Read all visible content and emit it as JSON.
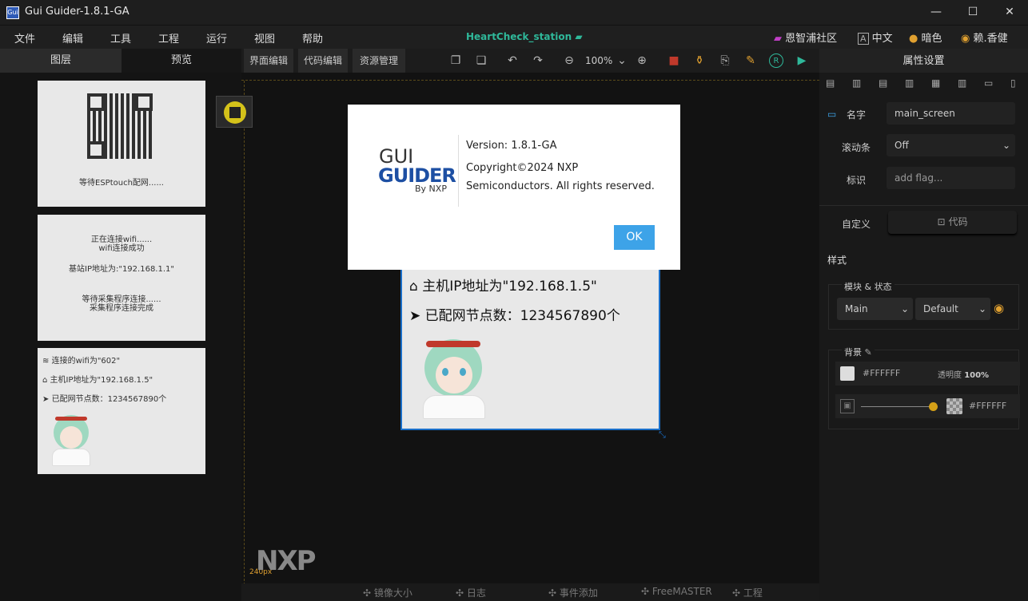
{
  "window": {
    "app_icon_text": "Gui",
    "title": "Gui Guider-1.8.1-GA",
    "minimize": "—",
    "maximize": "☐",
    "close": "✕"
  },
  "menu": {
    "items": [
      "文件",
      "编辑",
      "工具",
      "工程",
      "运行",
      "视图",
      "帮助"
    ],
    "project": "HeartCheck_station",
    "community": "恩智浦社区",
    "language": "中文",
    "theme": "暗色",
    "user": "赖.香健"
  },
  "left_panel": {
    "tab_layers": "图层",
    "tab_preview": "预览",
    "thumb1": {
      "caption": "等待ESPtouch配网......"
    },
    "thumb2": {
      "line1": "正在连接wifi......",
      "line2": "wifi连接成功",
      "line3": "基站IP地址为:\"192.168.1.1\"",
      "line4": "等待采集程序连接......",
      "line5": "采集程序连接完成"
    },
    "thumb3": {
      "wifi": "连接的wifi为\"602\"",
      "ip": "主机IP地址为\"192.168.1.5\"",
      "nodes": "已配网节点数：1234567890个"
    }
  },
  "editor": {
    "tab_ui": "界面编辑",
    "tab_code": "代码编辑",
    "tab_resources": "资源管理",
    "zoom": "100%",
    "ruler_label": "240px",
    "canvas": {
      "ip": "主机IP地址为\"192.168.1.5\"",
      "nodes": "已配网节点数：1234567890个"
    },
    "bottom_tabs": [
      "镜像大小",
      "日志",
      "事件添加",
      "FreeMASTER",
      "工程"
    ],
    "watermark": "NXP"
  },
  "right_panel": {
    "title": "属性设置",
    "name_label": "名字",
    "name_value": "main_screen",
    "scroll_label": "滚动条",
    "scroll_value": "Off",
    "flag_label": "标识",
    "flag_placeholder": "add flag...",
    "custom_label": "自定义",
    "code_button": "代码",
    "style_label": "样式",
    "module_state_label": "模块 & 状态",
    "module_value": "Main",
    "state_value": "Default",
    "background_label": "背景",
    "bg_color": "#FFFFFF",
    "opacity_label": "透明度",
    "opacity_value": "100%",
    "image_color": "#FFFFFF"
  },
  "dialog": {
    "logo_line1": "GUI",
    "logo_line2": "GUIDER",
    "logo_line3": "By NXP",
    "version": "Version: 1.8.1-GA",
    "copyright_line1": "Copyright©2024 NXP",
    "copyright_line2": "Semiconductors. All rights reserved.",
    "ok": "OK"
  },
  "colors": {
    "accent_blue": "#3da3e8",
    "project_green": "#2fb89a",
    "logo_blue": "#1d4fa3"
  }
}
